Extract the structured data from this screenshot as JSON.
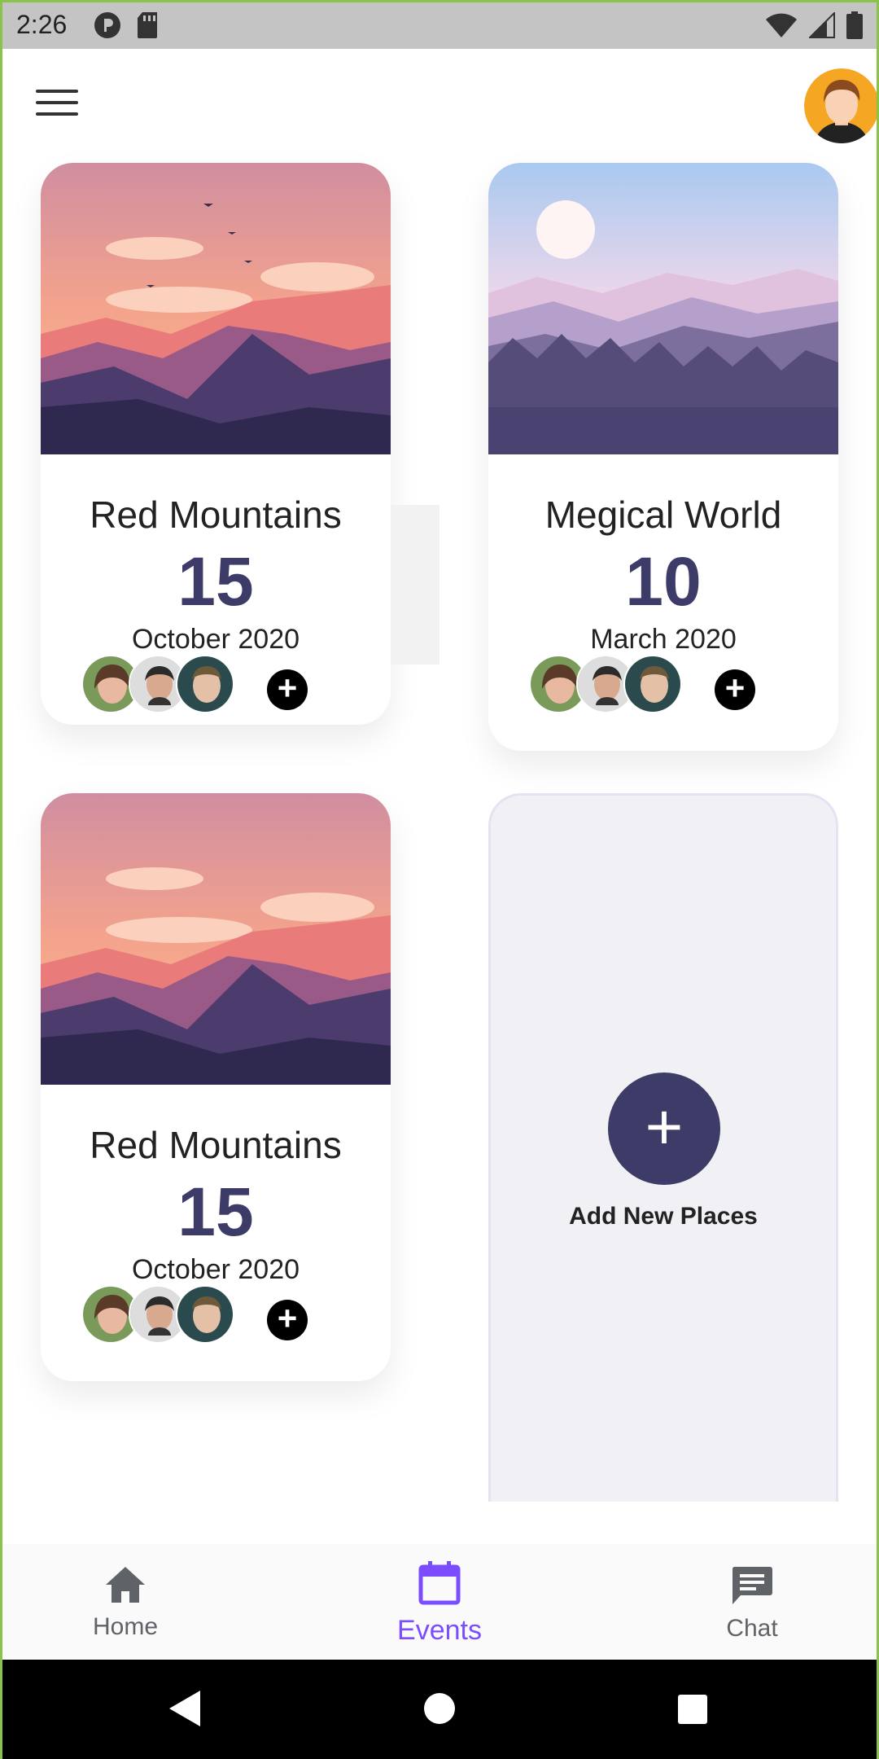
{
  "status_bar": {
    "time": "2:26"
  },
  "cards": [
    {
      "title": "Red Mountains",
      "day": "15",
      "month_year": "October 2020"
    },
    {
      "title": "Megical World",
      "day": "10",
      "month_year": "March 2020"
    },
    {
      "title": "Red Mountains",
      "day": "15",
      "month_year": "October 2020"
    }
  ],
  "add_card": {
    "label": "Add New Places",
    "icon": "plus-icon"
  },
  "bottom_nav": {
    "items": [
      {
        "label": "Home",
        "icon": "home-icon"
      },
      {
        "label": "Events",
        "icon": "calendar-icon"
      },
      {
        "label": "Chat",
        "icon": "chat-icon"
      }
    ],
    "active_index": 1
  },
  "colors": {
    "accent": "#7c4dff",
    "primary_dark": "#3d3b67",
    "status_bar": "#c4c4c4"
  }
}
